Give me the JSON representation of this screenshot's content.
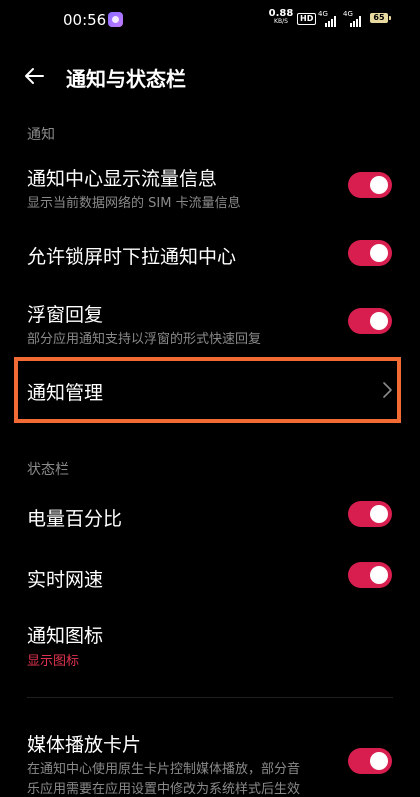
{
  "status_bar": {
    "time": "00:56",
    "net_speed_value": "0.88",
    "net_speed_unit": "KB/S",
    "hd_badge": "HD",
    "sim1_label": "4G",
    "sim2_label": "4G",
    "battery_level": "65"
  },
  "header": {
    "title": "通知与状态栏"
  },
  "sections": {
    "notify_label": "通知",
    "statusbar_label": "状态栏"
  },
  "items": {
    "traffic_info": {
      "title": "通知中心显示流量信息",
      "subtitle": "显示当前数据网络的 SIM 卡流量信息",
      "on": true
    },
    "lockscreen_pull": {
      "title": "允许锁屏时下拉通知中心",
      "on": true
    },
    "float_reply": {
      "title": "浮窗回复",
      "subtitle": "部分应用通知支持以浮窗的形式快速回复",
      "on": true
    },
    "notify_manage": {
      "title": "通知管理"
    },
    "battery_percent": {
      "title": "电量百分比",
      "on": true
    },
    "realtime_speed": {
      "title": "实时网速",
      "on": true
    },
    "notify_icons": {
      "title": "通知图标",
      "value": "显示图标"
    },
    "media_card": {
      "title": "媒体播放卡片",
      "subtitle_line1": "在通知中心使用原生卡片控制媒体播放，部分音",
      "subtitle_line2": "乐应用需要在应用设置中修改为系统样式后生效",
      "on": true
    }
  },
  "colors": {
    "accent_toggle": "#d81e4f",
    "highlight_border": "#f36b34",
    "value_red": "#e0334f"
  }
}
